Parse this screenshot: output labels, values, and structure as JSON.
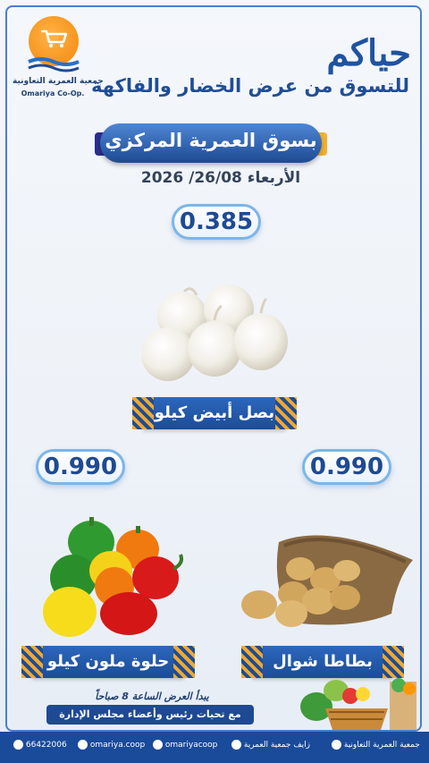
{
  "logo": {
    "name_ar": "جمعية العمرية التعاونية",
    "name_en": "Omariya Co-Op."
  },
  "header": {
    "title": "حياكم",
    "subtitle": "للتسوق من عرض الخضار والفاكهة",
    "banner": "بسوق العمرية المركزي",
    "date": "الأربعاء 26/08/ 2026"
  },
  "products": [
    {
      "name": "بصل أبيض كيلو",
      "price": "0.385"
    },
    {
      "name": "حلوة ملون كيلو",
      "price": "0.990"
    },
    {
      "name": "بطاطا شوال",
      "price": "0.990"
    }
  ],
  "footer": {
    "start_note": "يبدأ العرض الساعة 8 صباحاً",
    "greeting": "مع تحيات رئيس وأعضاء مجلس الإدارة"
  },
  "contacts": {
    "whatsapp": "66422006",
    "instagram": "omariya.coop",
    "x": "omariyacoop",
    "snapchat": "زايف جمعية العمرية",
    "youtube": "جمعية العمرية التعاونية"
  },
  "colors": {
    "primary": "#1f53a0",
    "accent_orange": "#f7941d",
    "bar": "#1a4a9a"
  }
}
